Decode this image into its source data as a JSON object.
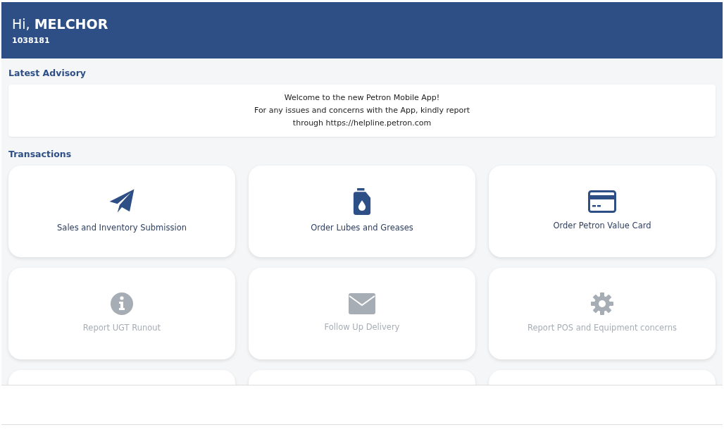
{
  "header": {
    "greeting": "Hi, **MELCHOR**",
    "account_number": "1038181"
  },
  "advisory": {
    "title": "Latest Advisory",
    "lines": [
      "Welcome to the new Petron Mobile App!",
      "For any issues and concerns with the App, kindly report",
      "through https://helpline.petron.com"
    ]
  },
  "transactions": {
    "title": "Transactions",
    "tiles": [
      {
        "label": "Sales and Inventory Submission",
        "kind": "plane",
        "disabled": false
      },
      {
        "label": "Order Lubes and Greases",
        "kind": "jug",
        "disabled": false
      },
      {
        "label": "Order Petron Value Card",
        "kind": "card",
        "disabled": false
      },
      {
        "label": "Report UGT Runout",
        "kind": "info",
        "disabled": true
      },
      {
        "label": "Follow Up Delivery",
        "kind": "envelope",
        "disabled": true
      },
      {
        "label": "Report POS and Equipment concerns",
        "kind": "gear",
        "disabled": true
      }
    ]
  }
}
